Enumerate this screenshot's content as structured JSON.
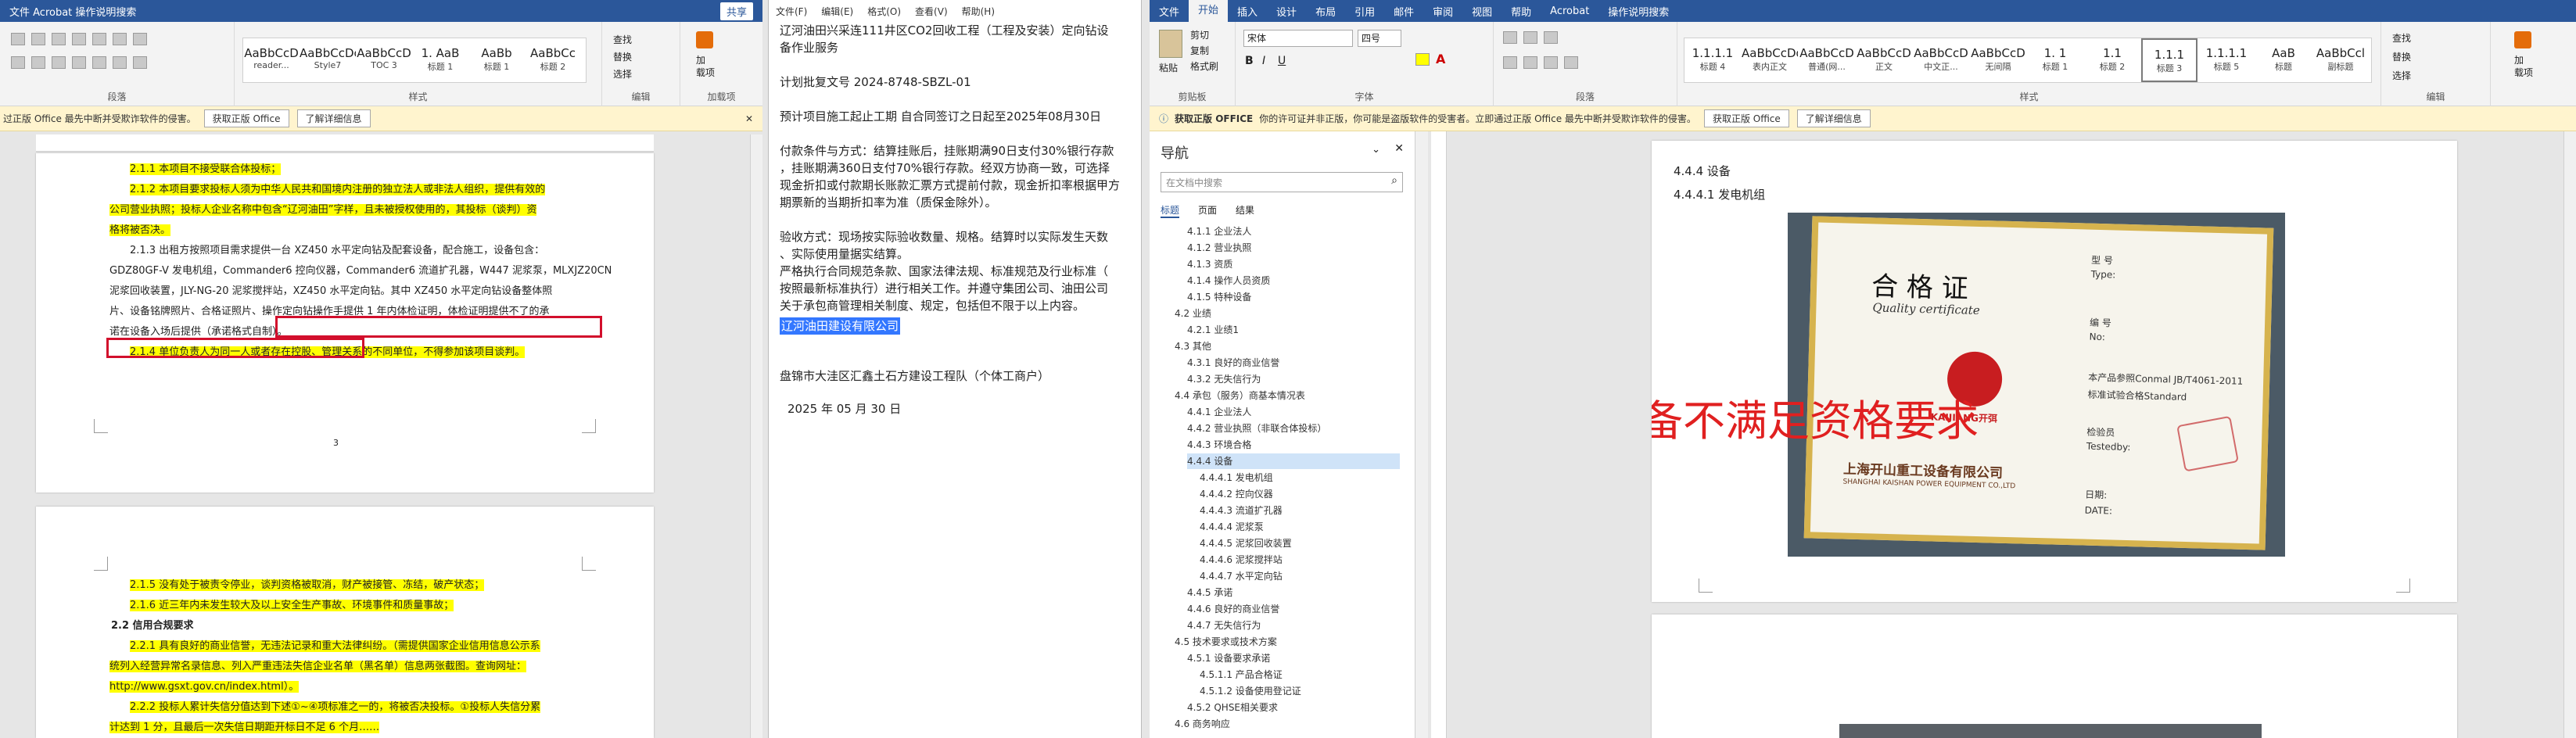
{
  "left": {
    "title_left": "文件  Acrobat  操作说明搜索",
    "share": "共享",
    "find": "查找",
    "replace": "替换",
    "select": "选择",
    "add_label1": "加",
    "add_label2": "载项",
    "styles": [
      {
        "preview": "AaBbCcD",
        "name": "reader..."
      },
      {
        "preview": "AaBbCcDc",
        "name": "Style7"
      },
      {
        "preview": "AaBbCcD",
        "name": "TOC 3"
      },
      {
        "preview": "1. AaB",
        "name": "标题 1"
      },
      {
        "preview": "AaBb",
        "name": "标题 1"
      },
      {
        "preview": "AaBbCc",
        "name": "标题 2"
      }
    ],
    "group_para": "段落",
    "group_style": "样式",
    "group_edit": "编辑",
    "group_addin": "加载项",
    "msg": "过正版 Office 最先中断并受欺诈软件的侵害。",
    "msg_btn1": "获取正版 Office",
    "msg_btn2": "了解详细信息",
    "page1_lines": [
      "2.1.1 本项目不接受联合体投标；",
      "2.1.2 本项目要求投标人须为中华人民共和国境内注册的独立法人或非法人组织，提供有效的",
      "公司营业执照；投标人企业名称中包含“辽河油田”字样，且未被授权使用的，其投标（谈判）资",
      "格将被否决。",
      "2.1.3 出租方按照项目需求提供一台 XZ450 水平定向钻及配套设备，配合施工，设备包含：",
      "GDZ80GF-V 发电机组，Commander6 控向仪器，Commander6 流道扩孔器，W447 泥浆泵，MLXJZ20CN",
      "泥浆回收装置，JLY-NG-20 泥浆搅拌站，XZ450 水平定向钻。其中 XZ450 水平定向钻设备整体照",
      "片、设备铭牌照片、合格证照片、操作定向钻操作手提供 1 年内体检证明，体检证明提供不了的承",
      "诺在设备入场后提供（承诺格式自制）。",
      "2.1.4 单位负责人为同一人或者存在控股、管理关系的不同单位，不得参加该项目谈判。"
    ],
    "page2_lines": [
      "2.1.5 没有处于被责令停业，谈判资格被取消，财产被接管、冻结，破产状态；",
      "2.1.6 近三年内未发生较大及以上安全生产事故、环境事件和质量事故；",
      "2.2 信用合规要求",
      "2.2.1 具有良好的商业信誉，无违法记录和重大法律纠纷。（需提供国家企业信用信息公示系",
      "统列入经营异常名录信息、列入严重违法失信企业名单（黑名单）信息两张截图。查询网址：",
      "http://www.gsxt.gov.cn/index.html）。",
      "2.2.2 投标人累计失信分值达到下述①~④项标准之一的，将被否决投标。①投标人失信分累",
      "计达到 1 分，且最后一次失信日期距开标日不足 6 个月……"
    ],
    "page_num": "3"
  },
  "mid": {
    "menu": [
      "文件(F)",
      "编辑(E)",
      "格式(O)",
      "查看(V)",
      "帮助(H)"
    ],
    "lines": [
      "辽河油田兴采连111井区CO2回收工程（工程及安装）定向钻设",
      "备作业服务",
      "",
      "计划批复文号          2024-8748-SBZL-01",
      "",
      "预计项目施工起止工期    自合同签订之日起至2025年08月30日",
      "",
      "付款条件与方式：结算挂账后，挂账期满90日支付30%银行存款",
      "，挂账期满360日支付70%银行存款。经双方协商一致，可选择",
      "现金折扣或付款期长账款汇票方式提前付款，现金折扣率根据甲方",
      "期票新的当期折扣率为准（质保金除外）。",
      "",
      "验收方式：现场按实际验收数量、规格。结算时以实际发生天数",
      "、实际使用量据实结算。",
      "严格执行合同规范条款、国家法律法规、标准规范及行业标准（",
      "按照最新标准执行）进行相关工作。并遵守集团公司、油田公司",
      "关于承包商管理相关制度、规定，包括但不限于以上内容。"
    ],
    "company": "辽河油田建设有限公司",
    "team": "盘锦市大洼区汇鑫土石方建设工程队（个体工商户）",
    "date": "2025 年 05 月 30 日"
  },
  "right": {
    "tabs": [
      "文件",
      "开始",
      "插入",
      "设计",
      "布局",
      "引用",
      "邮件",
      "审阅",
      "视图",
      "帮助",
      "Acrobat",
      "操作说明搜索"
    ],
    "active_tab": "开始",
    "font_name": "宋体",
    "font_size": "四号",
    "styles": [
      {
        "preview": "1.1.1.1",
        "name": "标题 4"
      },
      {
        "preview": "AaBbCcDd",
        "name": "表内正文"
      },
      {
        "preview": "AaBbCcD",
        "name": "普通(网..."
      },
      {
        "preview": "AaBbCcD",
        "name": "正文"
      },
      {
        "preview": "AaBbCcD",
        "name": "中文正..."
      },
      {
        "preview": "AaBbCcD",
        "name": "无间隔"
      },
      {
        "preview": "1. 1",
        "name": "标题 1"
      },
      {
        "preview": "1.1",
        "name": "标题 2"
      },
      {
        "preview": "1.1.1",
        "name": "标题 3"
      },
      {
        "preview": "1.1.1.1",
        "name": "标题 5"
      },
      {
        "preview": "AaB",
        "name": "标题"
      },
      {
        "preview": "AaBbCcl",
        "name": "副标题"
      }
    ],
    "clipboard": "剪贴板",
    "paste": "粘贴",
    "cut": "剪切",
    "copy": "复制",
    "painter": "格式刷",
    "group_font": "字体",
    "group_para": "段落",
    "group_style": "样式",
    "group_edit": "编辑",
    "find": "查找",
    "replace": "替换",
    "select": "选择",
    "addin1": "加",
    "addin2": "载项",
    "msg_label": "获取正版 OFFICE",
    "msg": "你的许可证并非正版，你可能是盗版软件的受害者。立即通过正版 Office 最先中断并受欺诈软件的侵害。",
    "msg_btn1": "获取正版 Office",
    "msg_btn2": "了解详细信息",
    "nav": {
      "title": "导航",
      "search_placeholder": "在文档中搜索",
      "tabs": [
        "标题",
        "页面",
        "结果"
      ],
      "items": [
        "4.1.1 企业法人",
        "4.1.2 营业执照",
        "4.1.3 资质",
        "4.1.4 操作人员资质",
        "4.1.5 特种设备",
        "4.2 业绩",
        "4.2.1 业绩1",
        "4.3 其他",
        "4.3.1 良好的商业信誉",
        "4.3.2 无失信行为",
        "4.4 承包（服务）商基本情况表",
        "4.4.1 企业法人",
        "4.4.2 营业执照（非联合体投标）",
        "4.4.3 环境合格",
        "4.4.4 设备",
        "4.4.4.1 发电机组",
        "4.4.4.2 控向仪器",
        "4.4.4.3 流道扩孔器",
        "4.4.4.4 泥浆泵",
        "4.4.4.5 泥浆回收装置",
        "4.4.4.6 泥浆搅拌站",
        "4.4.4.7 水平定向钻",
        "4.4.5 承诺",
        "4.4.6 良好的商业信誉",
        "4.4.7 无失信行为",
        "4.5 技术要求或技术方案",
        "4.5.1 设备要求承诺",
        "4.5.1.1 产品合格证",
        "4.5.1.2 设备使用登记证",
        "4.5.2 QHSE相关要求",
        "4.6 商务响应"
      ],
      "selected": "4.4.4 设备"
    },
    "doc_h1": "4.4.4  设备",
    "doc_h2": "4.4.4.1      发电机组",
    "cert_title": "合 格 证",
    "cert_sub": "Quality certificate",
    "cert_fields": [
      "型  号",
      "Type:",
      "编  号",
      "No:",
      "本产品参照Conmal JB/T4061-2011",
      "标准试验合格Standard",
      "检验员",
      "Testedby:",
      "日期:",
      "DATE:"
    ],
    "cert_company": "上海开山重工设备有限公司",
    "cert_company_en": "SHANGHAI KAISHAN POWER EQUIPMENT CO.,LTD",
    "cert_logo": "KAIJIANG开弭",
    "annotation": "设备不满足资格要求"
  }
}
